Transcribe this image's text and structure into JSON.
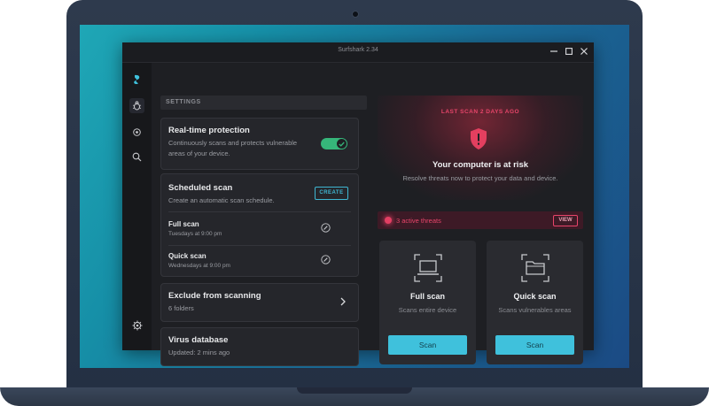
{
  "window": {
    "title": "Surfshark 2.34"
  },
  "sidebar": {
    "items": [
      {
        "icon": "surfshark-logo-icon"
      },
      {
        "icon": "bug-icon"
      },
      {
        "icon": "shield-gear-icon"
      },
      {
        "icon": "search-icon"
      },
      {
        "icon": "settings-gear-icon"
      }
    ]
  },
  "settings": {
    "header": "SETTINGS",
    "realtime": {
      "title": "Real-time protection",
      "description": "Continuously scans and protects vulnerable areas of your device.",
      "enabled": true
    },
    "scheduled": {
      "title": "Scheduled scan",
      "description": "Create an automatic scan schedule.",
      "create_label": "CREATE",
      "rows": [
        {
          "title": "Full scan",
          "schedule": "Tuesdays at 9:00 pm"
        },
        {
          "title": "Quick scan",
          "schedule": "Wednesdays at 9:00 pm"
        }
      ]
    },
    "exclude": {
      "title": "Exclude from scanning",
      "subtitle": "6 folders"
    },
    "database": {
      "title": "Virus database",
      "subtitle": "Updated: 2 mins ago"
    }
  },
  "status": {
    "last_scan": "LAST SCAN 2 DAYS AGO",
    "title": "Your computer is at risk",
    "subtitle": "Resolve threats now to protect your data and device."
  },
  "threats": {
    "text": "3 active threats",
    "view_label": "VIEW"
  },
  "scans": [
    {
      "title": "Full scan",
      "description": "Scans entire device",
      "button": "Scan",
      "icon": "laptop-icon"
    },
    {
      "title": "Quick scan",
      "description": "Scans vulnerables areas",
      "button": "Scan",
      "icon": "folder-icon"
    }
  ],
  "colors": {
    "accent": "#3fc1dc",
    "danger": "#e8456a",
    "toggle_on": "#36b67a",
    "background": "#1e1f23"
  }
}
